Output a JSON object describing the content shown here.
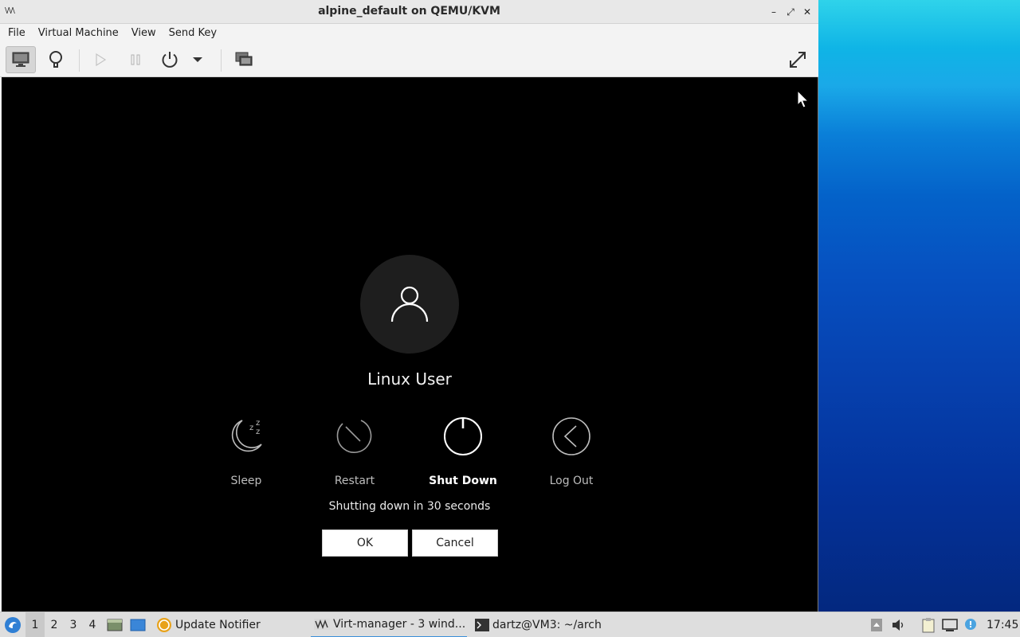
{
  "window": {
    "title": "alpine_default on QEMU/KVM",
    "app_icon_text": "\\/\\/\\",
    "minimize": "–",
    "maximize": "⤢",
    "close": "✕"
  },
  "menubar": {
    "items": [
      "File",
      "Virtual Machine",
      "View",
      "Send Key"
    ]
  },
  "vm": {
    "user_name": "Linux User",
    "actions": [
      {
        "label": "Sleep",
        "icon": "sleep-icon",
        "selected": false
      },
      {
        "label": "Restart",
        "icon": "restart-icon",
        "selected": false
      },
      {
        "label": "Shut Down",
        "icon": "power-icon",
        "selected": true
      },
      {
        "label": "Log Out",
        "icon": "logout-icon",
        "selected": false
      }
    ],
    "countdown": "Shutting down in 30 seconds",
    "ok_label": "OK",
    "cancel_label": "Cancel"
  },
  "taskbar": {
    "workspaces": [
      "1",
      "2",
      "3",
      "4"
    ],
    "active_workspace": "1",
    "tasks": [
      {
        "label": "Update Notifier",
        "icon": "update-notifier-icon"
      },
      {
        "label": "Virt-manager - 3 wind...",
        "icon": "virt-manager-icon",
        "active": true
      },
      {
        "label": "dartz@VM3: ~/arch",
        "icon": "terminal-icon"
      }
    ],
    "clock": "17:45"
  },
  "colors": {
    "accent": "#3b8fd9",
    "vm_background": "#000000",
    "avatar_background": "#1e1e1e"
  }
}
